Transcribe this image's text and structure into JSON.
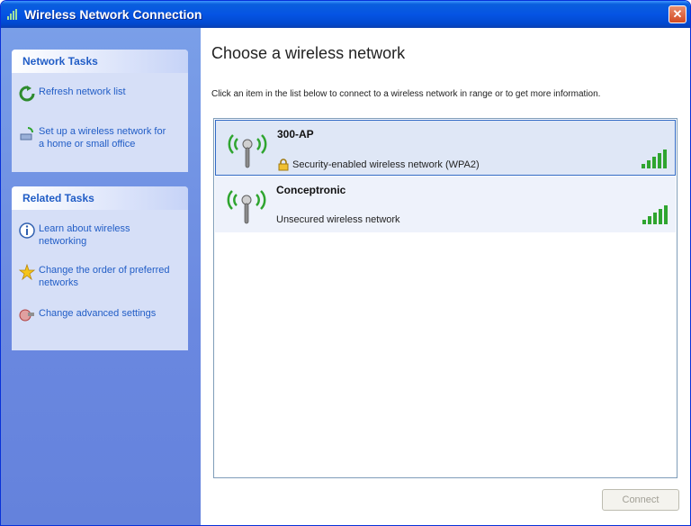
{
  "window": {
    "title": "Wireless Network Connection"
  },
  "network_tasks": {
    "header": "Network Tasks",
    "items": [
      {
        "label": "Refresh network list",
        "icon": "refresh-icon"
      },
      {
        "label": "Set up a wireless network for a home or small office",
        "icon": "setup-wireless-icon"
      }
    ]
  },
  "related_tasks": {
    "header": "Related Tasks",
    "items": [
      {
        "label": "Learn about wireless networking",
        "icon": "info-icon"
      },
      {
        "label": "Change the order of preferred networks",
        "icon": "star-icon"
      },
      {
        "label": "Change advanced settings",
        "icon": "advanced-settings-icon"
      }
    ]
  },
  "main": {
    "heading": "Choose a wireless network",
    "instruction": "Click an item in the list below to connect to a wireless network in range or to get more information.",
    "networks": [
      {
        "ssid": "300-AP",
        "security": "Security-enabled wireless network (WPA2)",
        "secured": true,
        "selected": true,
        "signal_bars": 5
      },
      {
        "ssid": "Conceptronic",
        "security": "Unsecured wireless network",
        "secured": false,
        "selected": false,
        "signal_bars": 5
      }
    ],
    "connect_label": "Connect"
  },
  "colors": {
    "title_blue": "#0554e3",
    "task_link": "#215dc6",
    "signal_green": "#2fa52f"
  }
}
